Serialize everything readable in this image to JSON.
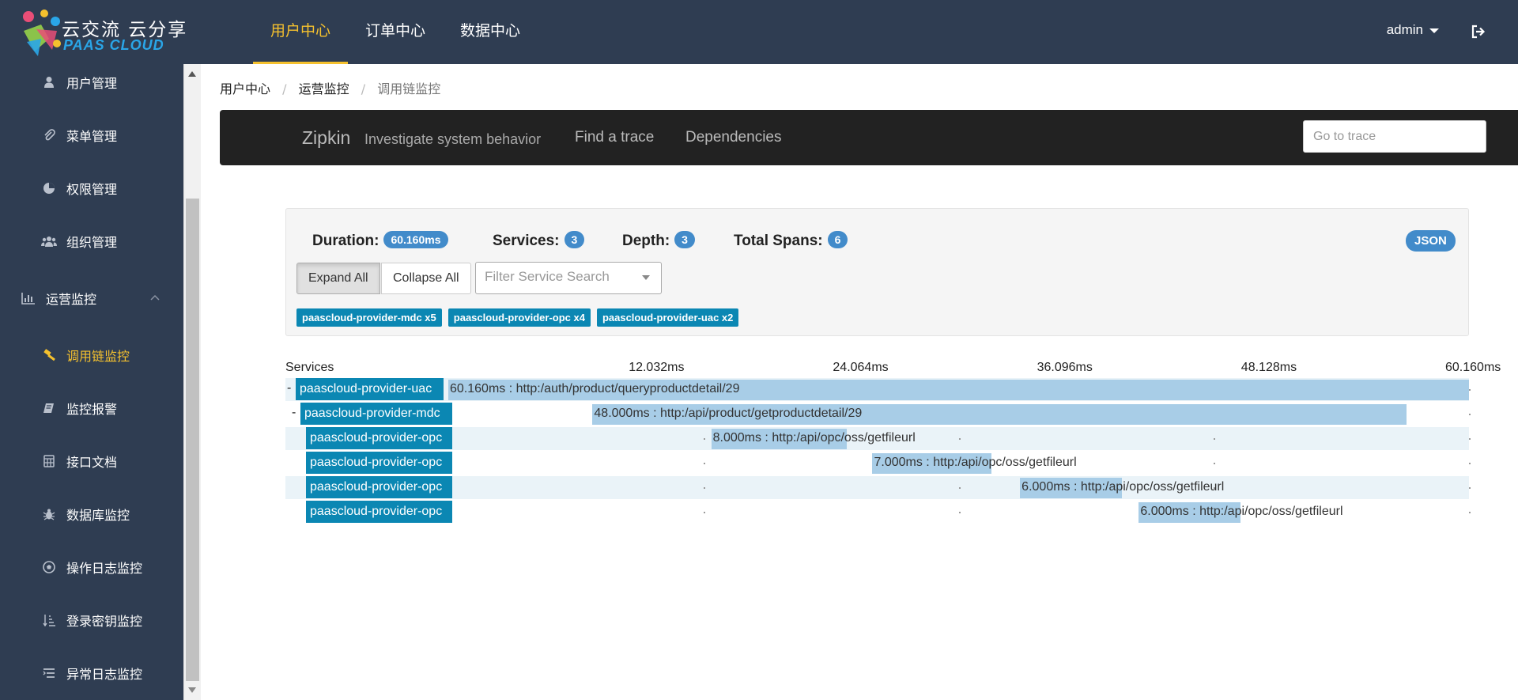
{
  "header": {
    "logo_title": "云交流 云分享",
    "logo_subtitle": "PAAS CLOUD",
    "nav": [
      "用户中心",
      "订单中心",
      "数据中心"
    ],
    "user": "admin",
    "accent_color": "#f5c12e",
    "bg_color": "#2f3d52"
  },
  "sidebar": {
    "items": [
      {
        "label": "用户管理",
        "icon": "user-icon"
      },
      {
        "label": "菜单管理",
        "icon": "paperclip-icon"
      },
      {
        "label": "权限管理",
        "icon": "pie-icon"
      },
      {
        "label": "组织管理",
        "icon": "group-icon"
      },
      {
        "label": "运营监控",
        "icon": "bar-chart-icon"
      },
      {
        "label": "调用链监控",
        "icon": "gavel-icon"
      },
      {
        "label": "监控报警",
        "icon": "book-icon"
      },
      {
        "label": "接口文档",
        "icon": "calculator-icon"
      },
      {
        "label": "数据库监控",
        "icon": "bug-icon"
      },
      {
        "label": "操作日志监控",
        "icon": "soccer-icon"
      },
      {
        "label": "登录密钥监控",
        "icon": "sort-icon"
      },
      {
        "label": "异常日志监控",
        "icon": "list-icon"
      }
    ]
  },
  "breadcrumb": [
    "用户中心",
    "运营监控",
    "调用链监控"
  ],
  "zipkin": {
    "brand": "Zipkin",
    "tagline": "Investigate system behavior",
    "links": [
      "Find a trace",
      "Dependencies"
    ],
    "goto_placeholder": "Go to trace"
  },
  "summary": {
    "duration_label": "Duration:",
    "duration": "60.160ms",
    "services_label": "Services:",
    "services": "3",
    "depth_label": "Depth:",
    "depth": "3",
    "spans_label": "Total Spans:",
    "spans": "6",
    "json": "JSON",
    "expand_all": "Expand All",
    "collapse_all": "Collapse All",
    "filter_placeholder": "Filter Service Search",
    "service_tags": [
      "paascloud-provider-mdc x5",
      "paascloud-provider-opc x4",
      "paascloud-provider-uac x2"
    ]
  },
  "timeline": {
    "services_header": "Services",
    "ticks": [
      "12.032ms",
      "24.064ms",
      "36.096ms",
      "48.128ms",
      "60.160ms"
    ],
    "total_ms": 60.16,
    "rows": [
      {
        "expander": "-",
        "service": "paascloud-provider-uac",
        "label": "60.160ms : http:/auth/product/queryproductdetail/29",
        "start_ms": 0,
        "duration_ms": 60.16,
        "depth": 0
      },
      {
        "expander": "-",
        "service": "paascloud-provider-mdc",
        "label": "48.000ms : http:/api/product/getproductdetail/29",
        "start_ms": 8.5,
        "duration_ms": 48.0,
        "depth": 1
      },
      {
        "expander": "",
        "service": "paascloud-provider-opc",
        "label": "8.000ms : http:/api/opc/oss/getfileurl",
        "start_ms": 15.5,
        "duration_ms": 8.0,
        "depth": 2
      },
      {
        "expander": "",
        "service": "paascloud-provider-opc",
        "label": "7.000ms : http:/api/opc/oss/getfileurl",
        "start_ms": 25.0,
        "duration_ms": 7.0,
        "depth": 2
      },
      {
        "expander": "",
        "service": "paascloud-provider-opc",
        "label": "6.000ms : http:/api/opc/oss/getfileurl",
        "start_ms": 33.7,
        "duration_ms": 6.0,
        "depth": 2
      },
      {
        "expander": "",
        "service": "paascloud-provider-opc",
        "label": "6.000ms : http:/api/opc/oss/getfileurl",
        "start_ms": 40.7,
        "duration_ms": 6.0,
        "depth": 2
      }
    ]
  }
}
